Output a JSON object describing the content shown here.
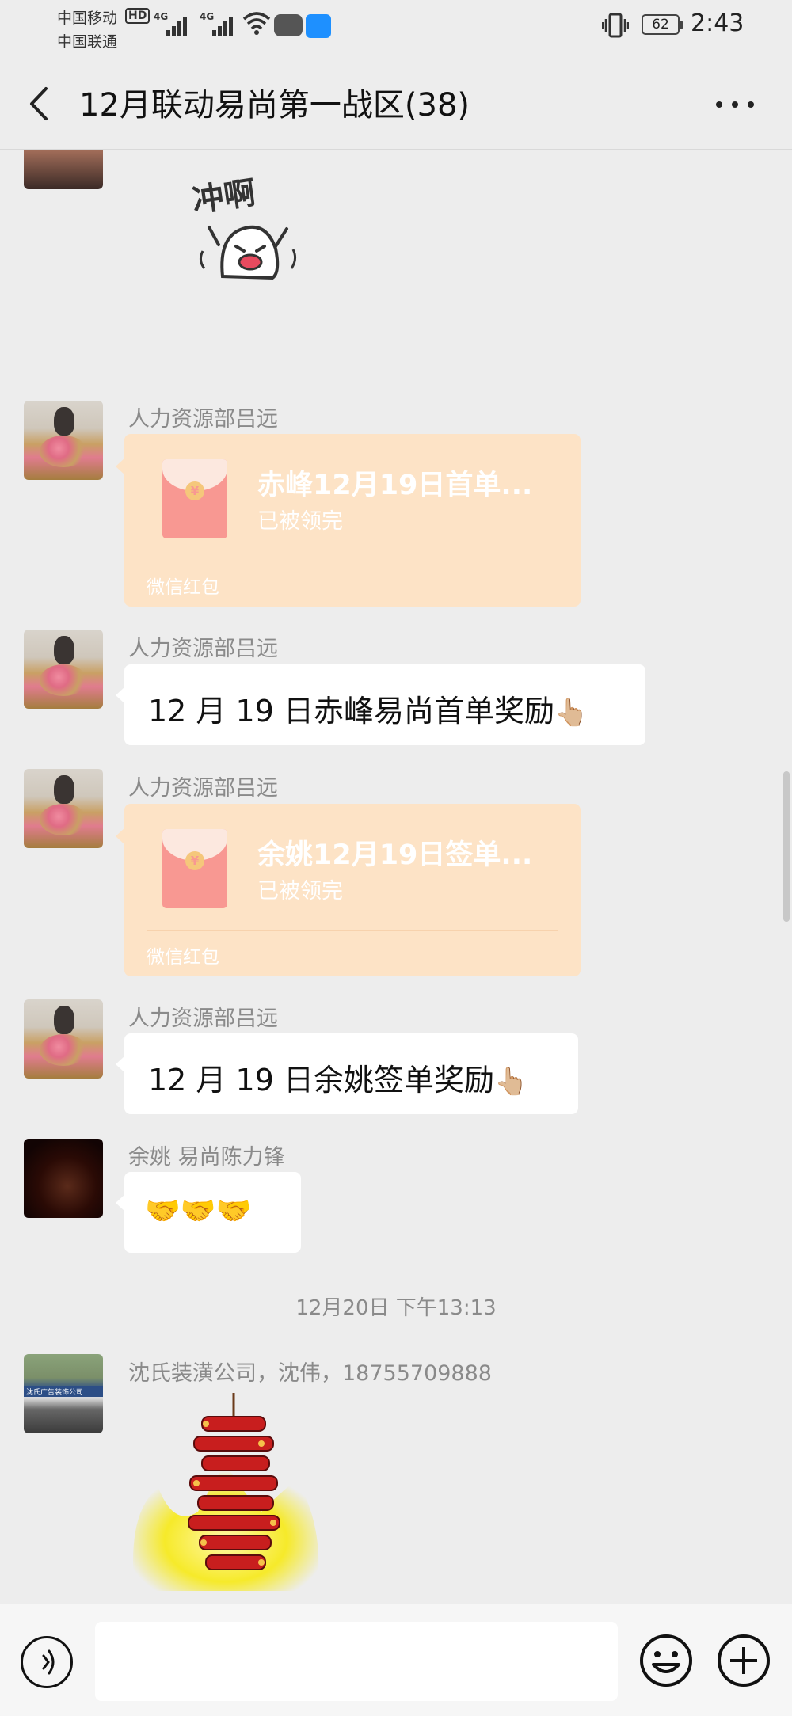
{
  "status_bar": {
    "carrier1": "中国移动",
    "carrier2": "中国联通",
    "hd": "HD",
    "net1": "4G",
    "net2": "4G",
    "battery": "62",
    "time": "2:43"
  },
  "header": {
    "title": "12月联动易尚第一战区(38)"
  },
  "messages": [
    {
      "sender": "人力资源部吕远",
      "red_packet": {
        "title": "赤峰12月19日首单...",
        "status": "已被领完",
        "footer": "微信红包"
      }
    },
    {
      "sender": "人力资源部吕远",
      "text": "12 月 19 日赤峰易尚首单奖励",
      "emoji": "👆🏼"
    },
    {
      "sender": "人力资源部吕远",
      "red_packet": {
        "title": "余姚12月19日签单...",
        "status": "已被领完",
        "footer": "微信红包"
      }
    },
    {
      "sender": "人力资源部吕远",
      "text": "12 月 19 日余姚签单奖励",
      "emoji": "👆🏼"
    },
    {
      "sender": "余姚 易尚陈力锋",
      "emoji": "🤝🤝🤝"
    },
    {
      "sender": "沈氏装潢公司，沈伟，18755709888"
    }
  ],
  "timestamp": "12月20日 下午13:13",
  "sticker_text": "冲啊",
  "avatar_text": "沈氏广告装饰公司",
  "input": {
    "placeholder": ""
  },
  "colors": {
    "background": "#ededed",
    "bubble": "#ffffff",
    "red_packet": "#fde3c6",
    "envelope": "#f89892"
  }
}
